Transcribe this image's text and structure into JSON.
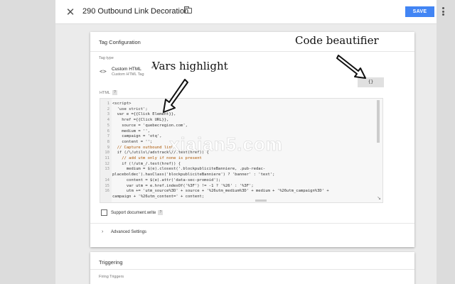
{
  "header": {
    "title": "290 Outbound Link Decoration",
    "save_label": "SAVE"
  },
  "tag_config": {
    "title": "Tag Configuration",
    "tag_type_label": "Tag type",
    "tag_name": "Custom HTML",
    "tag_sub": "Custom HTML Tag",
    "html_label": "HTML",
    "help_glyph": "?",
    "beautify_label": "{}",
    "support_label": "Support document.write",
    "advanced_label": "Advanced Settings"
  },
  "code_lines": [
    {
      "n": "1",
      "text": "<script>"
    },
    {
      "n": "2",
      "text": "  'use strict';"
    },
    {
      "n": "3",
      "text": "  var e ={{Click Element}},"
    },
    {
      "n": "4",
      "text": "    href ={{Click URL}},"
    },
    {
      "n": "5",
      "text": "    source = 'quebecregion.com',"
    },
    {
      "n": "6",
      "text": "    medium = '',"
    },
    {
      "n": "7",
      "text": "    campaign = 'otq',"
    },
    {
      "n": "8",
      "text": "    content = '';"
    },
    {
      "n": "9",
      "text": "  // Capture outbound link"
    },
    {
      "n": "10",
      "text": "  if (/\\/utils\\/adstrack\\//.test(href)) {"
    },
    {
      "n": "11",
      "text": "    // add utm only if none is present"
    },
    {
      "n": "12",
      "text": "    if (!/utm_/.test(href)) {"
    },
    {
      "n": "13",
      "text": "      medium = $(e).closest('.blockpubliciteBanniere, .pub-redac-"
    },
    {
      "n": "",
      "text": "placeboldec').hasClass('blockpubliciteBanniere') ? 'banner' : 'text';"
    },
    {
      "n": "14",
      "text": "      content = $(e).attr('data-sec-promoid');"
    },
    {
      "n": "15",
      "text": "      var utm = e.href.indexOf('%3F') != -1 ? '%26' : '%3F';"
    },
    {
      "n": "16",
      "text": "      utm += 'utm_source%3D' + source + '%26utm_medium%3D' + medium + '%26utm_campaign%3D' +"
    },
    {
      "n": "",
      "text": "campaign + '%26utm_content=' + content;"
    }
  ],
  "triggering": {
    "title": "Triggering",
    "firing_label": "Firing Triggers"
  },
  "annotations": {
    "code": "Code beautifier",
    "vars": "Vars highlight"
  },
  "watermark": "xiaian5.com",
  "colors": {
    "accent": "#4285f4",
    "page_bg": "#ebebeb"
  }
}
